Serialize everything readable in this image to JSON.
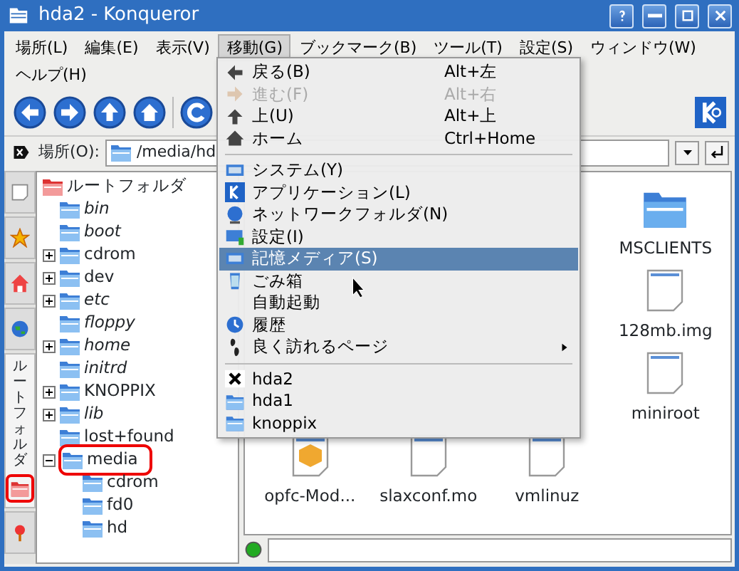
{
  "window": {
    "title": "hda2 - Konqueror"
  },
  "menubar": [
    {
      "label": "場所(L)",
      "selected": false
    },
    {
      "label": "編集(E)",
      "selected": false
    },
    {
      "label": "表示(V)",
      "selected": false
    },
    {
      "label": "移動(G)",
      "selected": true
    },
    {
      "label": "ブックマーク(B)",
      "selected": false
    },
    {
      "label": "ツール(T)",
      "selected": false
    },
    {
      "label": "設定(S)",
      "selected": false
    },
    {
      "label": "ウィンドウ(W)",
      "selected": false
    },
    {
      "label": "ヘルプ(H)",
      "selected": false
    }
  ],
  "location_bar": {
    "label": "場所(O):",
    "value": "/media/hd"
  },
  "sidebar_tabs": [
    {
      "selected": false
    },
    {
      "selected": false
    },
    {
      "selected": false
    },
    {
      "selected": false
    },
    {
      "selected": true,
      "label": "ルートフォルダ"
    },
    {
      "selected": false
    }
  ],
  "tree": {
    "label": "ルートフォルダ",
    "children": [
      {
        "label": "bin",
        "kind": "link"
      },
      {
        "label": "boot",
        "kind": "link"
      },
      {
        "label": "cdrom",
        "kind": "dir",
        "expanded": false
      },
      {
        "label": "dev",
        "kind": "dir",
        "expanded": false
      },
      {
        "label": "etc",
        "kind": "link",
        "expanded": false
      },
      {
        "label": "floppy",
        "kind": "link"
      },
      {
        "label": "home",
        "kind": "link",
        "expanded": false
      },
      {
        "label": "initrd",
        "kind": "link"
      },
      {
        "label": "KNOPPIX",
        "kind": "dir",
        "expanded": false
      },
      {
        "label": "lib",
        "kind": "link",
        "expanded": false
      },
      {
        "label": "lost+found",
        "kind": "dir"
      },
      {
        "label": "media",
        "kind": "dir",
        "expanded": true,
        "highlighted": true,
        "children": [
          {
            "label": "cdrom"
          },
          {
            "label": "fd0"
          },
          {
            "label": "hd"
          }
        ]
      }
    ]
  },
  "files": [
    {
      "label": "MSCLIENTS",
      "kind": "folder"
    },
    {
      "label": "128mb.img",
      "kind": "file"
    },
    {
      "label": "miniroot",
      "kind": "file"
    },
    {
      "label": "opfc-Mod...",
      "kind": "package"
    },
    {
      "label": "slaxconf.mo",
      "kind": "file"
    },
    {
      "label": "vmlinuz",
      "kind": "file"
    }
  ],
  "go_menu": [
    {
      "label": "戻る(B)",
      "shortcut": "Alt+左",
      "disabled": false,
      "selected": false
    },
    {
      "label": "進む(F)",
      "shortcut": "Alt+右",
      "disabled": true,
      "selected": false
    },
    {
      "label": "上(U)",
      "shortcut": "Alt+上",
      "disabled": false,
      "selected": false
    },
    {
      "label": "ホーム",
      "shortcut": "Ctrl+Home",
      "disabled": false,
      "selected": false,
      "separator_after": true
    },
    {
      "label": "システム(Y)",
      "disabled": false,
      "selected": false
    },
    {
      "label": "アプリケーション(L)",
      "disabled": false,
      "selected": false
    },
    {
      "label": "ネットワークフォルダ(N)",
      "disabled": false,
      "selected": false
    },
    {
      "label": "設定(I)",
      "disabled": false,
      "selected": false
    },
    {
      "label": "記憶メディア(S)",
      "disabled": false,
      "selected": true
    },
    {
      "label": "ごみ箱",
      "disabled": false,
      "selected": false
    },
    {
      "label": "自動起動",
      "disabled": false,
      "selected": false
    },
    {
      "label": "履歴",
      "disabled": false,
      "selected": false
    },
    {
      "label": "良く訪れるページ",
      "disabled": false,
      "selected": false,
      "submenu": true,
      "separator_after": true
    },
    {
      "label": "hda2",
      "disabled": false,
      "selected": false
    },
    {
      "label": "hda1",
      "disabled": false,
      "selected": false
    },
    {
      "label": "knoppix",
      "disabled": false,
      "selected": false
    }
  ]
}
